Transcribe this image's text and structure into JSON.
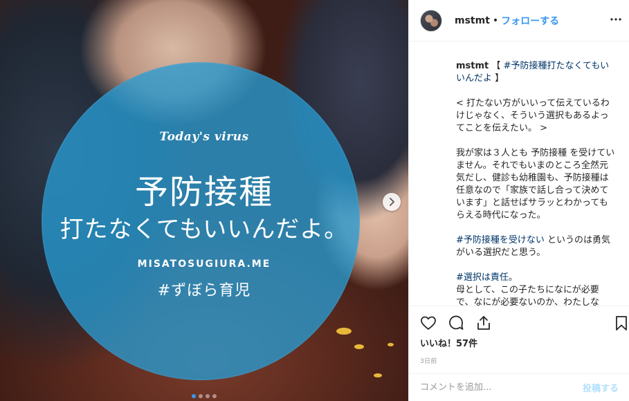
{
  "media": {
    "today_text": "Today's virus",
    "title": "予防接種",
    "subtitle": "打たなくてもいいんだよ。",
    "site": "MISATOSUGIURA.ME",
    "hashtag": "#ずぼら育児",
    "carousel": {
      "count": 4,
      "active_index": 0
    },
    "colors": {
      "circle": "#289bd2",
      "active_dot": "#3897f0"
    },
    "next_icon": "chevron-right-icon"
  },
  "header": {
    "username": "mstmt",
    "separator": "•",
    "follow_label": "フォローする",
    "more_icon": "more-horizontal-icon"
  },
  "caption": {
    "username": "mstmt",
    "lines": [
      {
        "t": "【 "
      },
      {
        "tag": "#予防接種打たなくてもいいんだよ"
      },
      {
        "t": " 】"
      }
    ],
    "p1": "< 打たない方がいいって伝えているわけじゃなく、そういう選択もあるよってことを伝えたい。 >",
    "p2": "我が家は３人とも 予防接種 を受けていません。それでもいまのところ全然元気だし、健診も幼稚園も、予防接種は任意なので「家族で話し合って決めています」と話せばサラッとわかってもらえる時代になった。",
    "p3_tag": "#予防接種を受けない",
    "p3_text": " というのは勇気がいる選択だと思う。",
    "p4_tag": "#選択は責任",
    "p4_text": "。",
    "p5": "母として、この子たちになにが必要で、なにが必要ないのか、わたしな"
  },
  "actions": {
    "like_icon": "heart-icon",
    "comment_icon": "comment-icon",
    "share_icon": "share-icon",
    "save_icon": "bookmark-icon"
  },
  "likes": "いいね！57件",
  "time": "3日前",
  "comment_box": {
    "placeholder": "コメントを追加...",
    "value": "",
    "post_label": "投稿する"
  },
  "colors": {
    "link": "#3897f0",
    "hashtag": "#003569",
    "post_disabled": "#b2dffc"
  }
}
